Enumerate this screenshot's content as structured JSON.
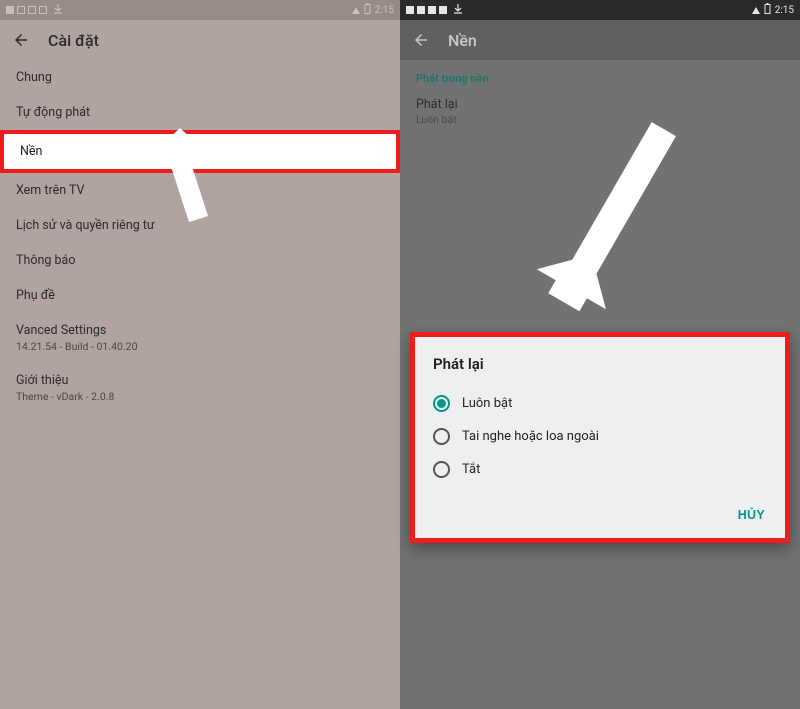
{
  "status": {
    "clock": "2:15"
  },
  "left": {
    "title": "Cài đặt",
    "rows": {
      "general": "Chung",
      "autoplay": "Tự động phát",
      "background": "Nền",
      "watch_tv": "Xem trên TV",
      "history": "Lịch sử và quyền riêng tư",
      "notifications": "Thông báo",
      "captions": "Phụ đề",
      "vanced_title": "Vanced Settings",
      "vanced_sub": "14.21.54 - Build - 01.40.20",
      "about_title": "Giới thiệu",
      "about_sub": "Theme - vDark - 2.0.8"
    }
  },
  "right": {
    "title": "Nền",
    "section": "Phát trong nền",
    "playback_title": "Phát lại",
    "playback_value": "Luôn bật"
  },
  "dialog": {
    "title": "Phát lại",
    "options": {
      "always": "Luôn bật",
      "headphones": "Tai nghe hoặc loa ngoài",
      "off": "Tắt"
    },
    "cancel": "HỦY"
  }
}
